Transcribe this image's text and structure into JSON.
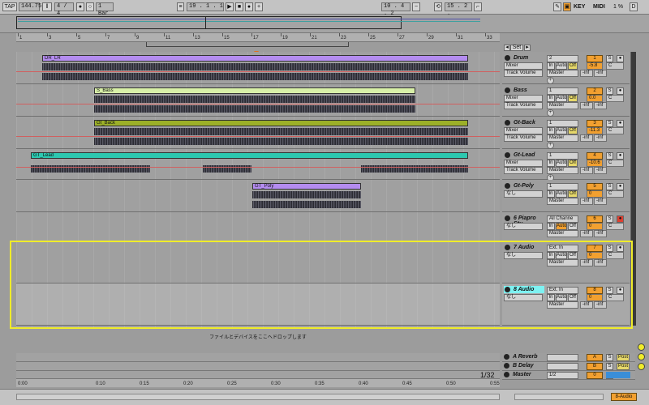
{
  "transport": {
    "tap": "TAP",
    "tempo": "144.75",
    "signature": "4 / 4",
    "quantize": "1 Bar",
    "position": "19 .   1 .   1",
    "loop_start": "10 .   4 .   2",
    "loop_length": "15 .   2 .",
    "key_label": "KEY",
    "midi_label": "MIDI",
    "cpu": "1 %"
  },
  "overview": {
    "bar_labels": [
      "1",
      "5",
      "9",
      "13",
      "17",
      "21",
      "25",
      "29"
    ]
  },
  "ruler": {
    "bar_labels": [
      "1",
      "3",
      "5",
      "7",
      "9",
      "11",
      "13",
      "15",
      "17",
      "19",
      "21",
      "23",
      "25",
      "27",
      "29",
      "31",
      "33"
    ],
    "set_label": "Set"
  },
  "tracks": [
    {
      "name": "Drum",
      "clip": "DR_LR",
      "clip_color": "#b48cf0",
      "number": "1",
      "input": "2",
      "monitor": "Mixer",
      "automation": "Track Volume",
      "output": "Master",
      "vol": "-5.8",
      "pan": "C",
      "sends": "-inf",
      "has_red_line": true
    },
    {
      "name": "Bass",
      "clip": "S_Bass",
      "clip_color": "#d8f0a8",
      "number": "2",
      "input": "1",
      "monitor": "Mixer",
      "automation": "Track Volume",
      "output": "Master",
      "vol": "0.0",
      "pan": "C",
      "sends": "-inf",
      "has_red_line": true
    },
    {
      "name": "Gt-Back",
      "clip": "Gt_Back",
      "clip_color": "#9cb028",
      "number": "3",
      "input": "1",
      "monitor": "Mixer",
      "automation": "Track Volume",
      "output": "Master",
      "vol": "-11.3",
      "pan": "C",
      "sends": "-inf",
      "has_red_line": true
    },
    {
      "name": "Gt-Lead",
      "clip": "GT_Lead",
      "clip_color": "#2cc8b0",
      "number": "4",
      "input": "1",
      "monitor": "Mixer",
      "automation": "Track Volume",
      "output": "Master",
      "vol": "-10.6",
      "pan": "C",
      "sends": "-inf",
      "has_red_line": true
    },
    {
      "name": "Gt-Poly",
      "clip": "GT_Poly",
      "clip_color": "#b48cf0",
      "number": "5",
      "input": "1",
      "monitor": "なし",
      "automation": "",
      "output": "Master",
      "vol": "0",
      "pan": "C",
      "sends": "-inf",
      "has_red_line": false
    },
    {
      "name": "6 Piapro Stu",
      "clip": "",
      "clip_color": "",
      "number": "6",
      "input": "All Channe",
      "monitor": "なし",
      "automation": "",
      "output": "Master",
      "vol": "0",
      "pan": "C",
      "sends": "-inf",
      "has_red_line": false
    },
    {
      "name": "7 Audio",
      "clip": "",
      "clip_color": "",
      "number": "7",
      "input": "Ext. In",
      "monitor": "なし",
      "automation": "",
      "output": "Master",
      "vol": "0",
      "pan": "C",
      "sends": "-inf",
      "has_red_line": false
    },
    {
      "name": "8 Audio",
      "clip": "",
      "clip_color": "",
      "number": "8",
      "input": "Ext. In",
      "monitor": "なし",
      "automation": "",
      "output": "Master",
      "vol": "0",
      "pan": "C",
      "sends": "-inf",
      "has_red_line": false
    }
  ],
  "monitor_buttons": {
    "in": "In",
    "auto": "Auto",
    "off": "Off"
  },
  "drop_hint": "ファイルとデバイスをここへドロップします",
  "returns": [
    {
      "name": "A Reverb",
      "letter": "A",
      "post": "Post"
    },
    {
      "name": "B Delay",
      "letter": "B",
      "post": "Post"
    },
    {
      "name": "Master",
      "letter": "0",
      "post": "1/2"
    }
  ],
  "timeline": {
    "labels": [
      "0:00",
      "0:10",
      "0:15",
      "0:20",
      "0:25",
      "0:30",
      "0:35",
      "0:40",
      "0:45",
      "0:50",
      "0:55"
    ],
    "zoom": "1/32"
  },
  "status": {
    "track_label": "8-Audio"
  },
  "colors": {
    "accent_orange": "#f2a030",
    "selection_highlight": "#f0ec2a",
    "selected_track": "#7ef2f2"
  }
}
